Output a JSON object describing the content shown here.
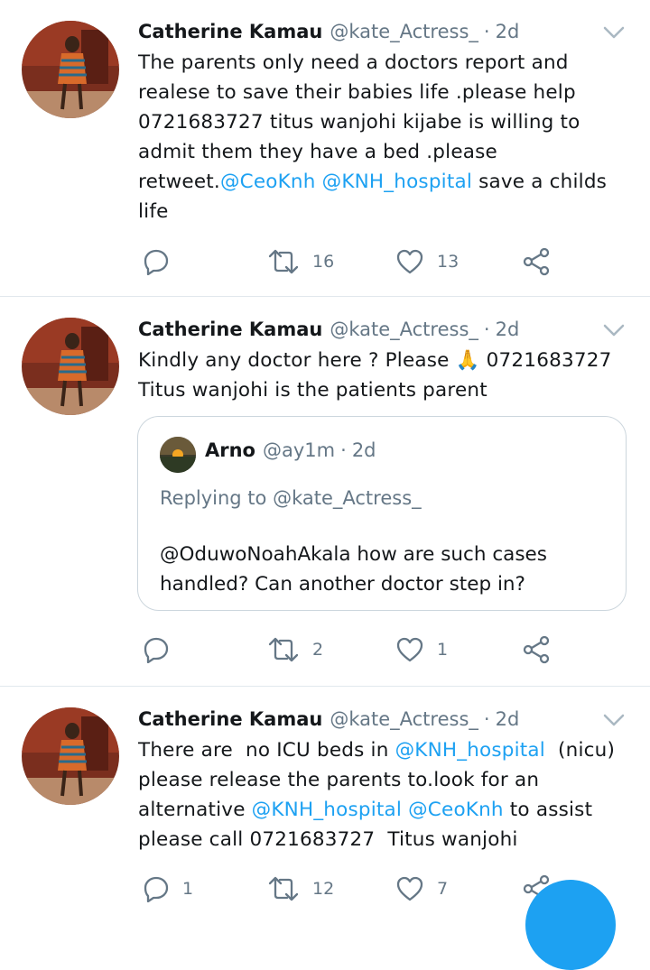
{
  "colors": {
    "accent": "#1da1f2",
    "secondary_text": "#657786",
    "primary_text": "#14171a"
  },
  "tweets": [
    {
      "name": "Catherine Kamau",
      "handle": "@kate_Actress_",
      "dot": "·",
      "time": "2d",
      "text_plain_1": "The parents only need a doctors report and realese to save their babies life .please help 0721683727 titus wanjohi kijabe is willing to admit them they have a bed .please retweet.",
      "mention_1": "@CeoKnh",
      "space_1": " ",
      "mention_2": "@KNH_hospital",
      "text_plain_2": " save a childs life",
      "reply_count": "",
      "retweet_count": "16",
      "like_count": "13"
    },
    {
      "name": "Catherine Kamau",
      "handle": "@kate_Actress_",
      "dot": "·",
      "time": "2d",
      "text_plain_1": "Kindly any doctor here ? Please ",
      "emoji": "🙏",
      "text_plain_2": " 0721683727 Titus wanjohi is the patients parent",
      "quote": {
        "name": "Arno",
        "handle": "@ay1m",
        "dot": "·",
        "time": "2d",
        "replying_to": "Replying to @kate_Actress_",
        "text": "@OduwoNoahAkala how are such cases handled? Can another doctor step in?"
      },
      "reply_count": "",
      "retweet_count": "2",
      "like_count": "1"
    },
    {
      "name": "Catherine Kamau",
      "handle": "@kate_Actress_",
      "dot": "·",
      "time": "2d",
      "text_plain_1": "There are  no ICU beds in ",
      "mention_1": "@KNH_hospital",
      "text_plain_2": "  (nicu) please release the parents to.look for an alternative ",
      "mention_2": "@KNH_hospital",
      "space_1": " ",
      "mention_3": "@CeoKnh",
      "text_plain_3": " to assist please call 0721683727  Titus wanjohi",
      "reply_count": "1",
      "retweet_count": "12",
      "like_count": "7"
    }
  ],
  "icons": {
    "reply": "reply-icon",
    "retweet": "retweet-icon",
    "like": "heart-icon",
    "share": "share-icon",
    "more": "chevron-down-icon",
    "compose": "compose-fab"
  }
}
